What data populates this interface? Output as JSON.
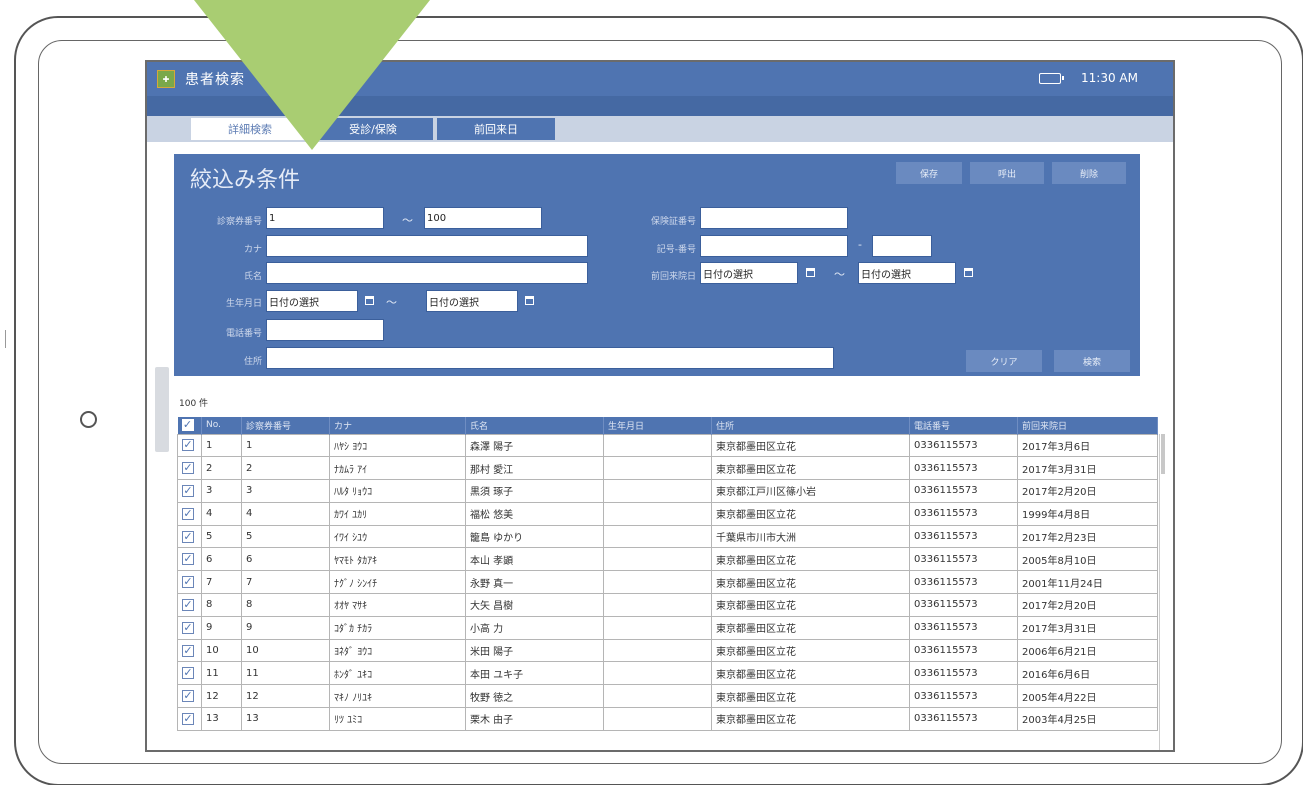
{
  "window": {
    "title": "患者検索",
    "clock": "11:30 AM",
    "battery": "■"
  },
  "tabs": [
    {
      "label": "詳細検索",
      "active": true
    },
    {
      "label": "受診/保険",
      "active": false
    },
    {
      "label": "前回来日",
      "active": false
    }
  ],
  "filter": {
    "title": "絞込み条件",
    "top_buttons": [
      "保存",
      "呼出",
      "削除"
    ],
    "fields": {
      "patient_no_label": "診察券番号",
      "patient_no_from": "1",
      "patient_no_to": "100",
      "kana_label": "カナ",
      "name_label": "氏名",
      "birth_label": "生年月日",
      "birth_from": "日付の選択",
      "birth_to": "日付の選択",
      "phone_label": "電話番号",
      "address_label": "住所",
      "insurance_no_label": "保険証番号",
      "symbol_no_label": "記号-番号",
      "last_visit_label": "前回来院日",
      "last_visit_from": "日付の選択",
      "last_visit_to": "日付の選択",
      "tilde": "〜",
      "dash": "-"
    },
    "clear_button": "クリア",
    "search_button": "検索"
  },
  "results": {
    "count": "100 件",
    "columns": [
      "",
      "No.",
      "診察券番号",
      "カナ",
      "氏名",
      "生年月日",
      "住所",
      "電話番号",
      "前回来院日"
    ],
    "rows": [
      [
        "1",
        "1",
        "ﾊﾔｼ ﾖｳｺ",
        "森澤 陽子",
        "",
        "東京都墨田区立花",
        "0336115573",
        "2017年3月6日"
      ],
      [
        "2",
        "2",
        "ﾅｶﾑﾗ ｱｲ",
        "那村 愛江",
        "",
        "東京都墨田区立花",
        "0336115573",
        "2017年3月31日"
      ],
      [
        "3",
        "3",
        "ﾊﾙﾀ ﾘｮｳｺ",
        "黒須 琢子",
        "",
        "東京都江戸川区篠小岩",
        "0336115573",
        "2017年2月20日"
      ],
      [
        "4",
        "4",
        "ｶﾜｲ ﾕｶﾘ",
        "福松 悠美",
        "",
        "東京都墨田区立花",
        "0336115573",
        "1999年4月8日"
      ],
      [
        "5",
        "5",
        "ｲﾜｲ ｼﾕｳ",
        "籠島 ゆかり",
        "",
        "千葉県市川市大洲",
        "0336115573",
        "2017年2月23日"
      ],
      [
        "6",
        "6",
        "ﾔﾏﾓﾄ ﾀｶｱｷ",
        "本山 孝顕",
        "",
        "東京都墨田区立花",
        "0336115573",
        "2005年8月10日"
      ],
      [
        "7",
        "7",
        "ﾅｸﾞﾉ ｼﾝｲﾁ",
        "永野 真一",
        "",
        "東京都墨田区立花",
        "0336115573",
        "2001年11月24日"
      ],
      [
        "8",
        "8",
        "ｵｵﾔ ﾏｻｷ",
        "大矢 昌樹",
        "",
        "東京都墨田区立花",
        "0336115573",
        "2017年2月20日"
      ],
      [
        "9",
        "9",
        "ｺﾀﾞｶ ﾁｶﾗ",
        "小高 力",
        "",
        "東京都墨田区立花",
        "0336115573",
        "2017年3月31日"
      ],
      [
        "10",
        "10",
        "ﾖﾈﾀﾞ ﾖｳｺ",
        "米田 陽子",
        "",
        "東京都墨田区立花",
        "0336115573",
        "2006年6月21日"
      ],
      [
        "11",
        "11",
        "ﾎﾝﾀﾞ ﾕｷｺ",
        "本田 ユキ子",
        "",
        "東京都墨田区立花",
        "0336115573",
        "2016年6月6日"
      ],
      [
        "12",
        "12",
        "ﾏｷﾉ ﾉﾘﾕｷ",
        "牧野 徳之",
        "",
        "東京都墨田区立花",
        "0336115573",
        "2005年4月22日"
      ],
      [
        "13",
        "13",
        "ﾘﾂ ﾕﾐｺ",
        "栗木 由子",
        "",
        "東京都墨田区立花",
        "0336115573",
        "2003年4月25日"
      ]
    ]
  },
  "colors": {
    "primary": "#4f74b1",
    "tab_strip": "#c9d3e3",
    "accent_arrow": "#a9cd72"
  }
}
